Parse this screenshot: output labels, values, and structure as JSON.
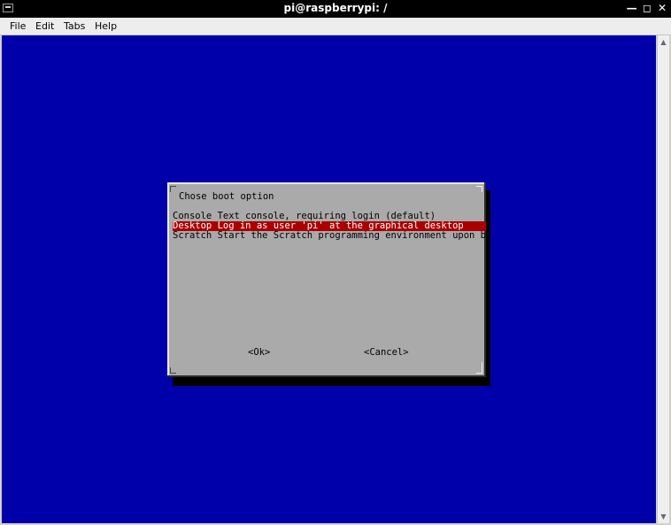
{
  "window": {
    "title": "pi@raspberrypi: /",
    "controls": {
      "minimize": "—",
      "maximize": "◻",
      "close": "✕"
    }
  },
  "menu": [
    "File",
    "Edit",
    "Tabs",
    "Help"
  ],
  "dialog": {
    "title": "Chose boot option",
    "options": [
      {
        "label": "Console Text console, requiring login (default)",
        "selected": false
      },
      {
        "label": "Desktop Log in as user 'pi' at the graphical desktop",
        "selected": true
      },
      {
        "label": "Scratch Start the Scratch programming environment upon boot",
        "selected": false
      }
    ],
    "ok_label": "<Ok>",
    "cancel_label": "<Cancel>"
  },
  "colors": {
    "terminal_background": "#0000aa",
    "dialog_background": "#aaaaaa",
    "selection_background": "#aa0000",
    "selection_text": "#ffffff"
  },
  "scrollbar": {
    "up_icon": "triangle-up",
    "down_icon": "triangle-down"
  }
}
